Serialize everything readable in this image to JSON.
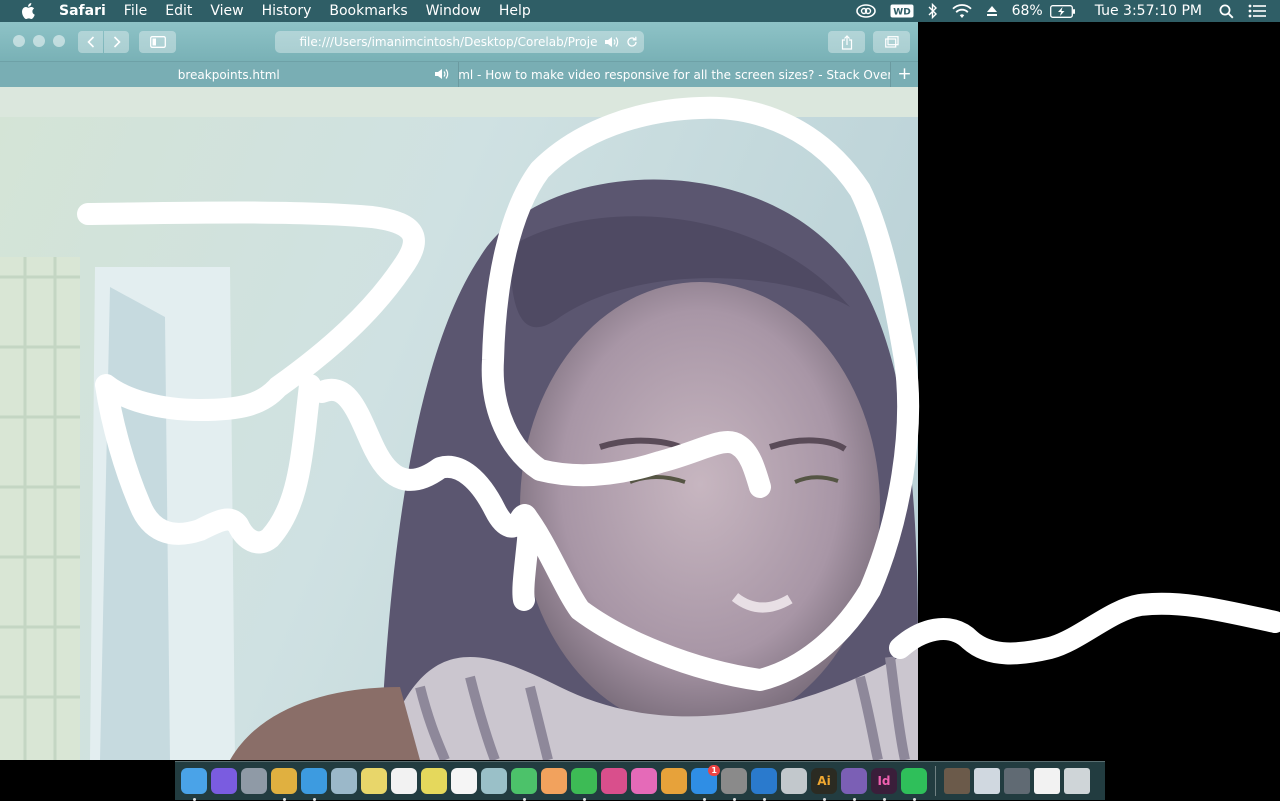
{
  "menubar": {
    "app_name": "Safari",
    "menus": [
      "File",
      "Edit",
      "View",
      "History",
      "Bookmarks",
      "Window",
      "Help"
    ],
    "battery_percent": "68%",
    "clock": "Tue 3:57:10 PM",
    "wd_label": "WD",
    "status_icons": [
      "creative-cloud-icon",
      "wd-drive-icon",
      "bluetooth-icon",
      "wifi-icon",
      "eject-icon",
      "battery-icon",
      "spotlight-search-icon",
      "notification-center-icon"
    ]
  },
  "browser": {
    "url": "file:///Users/imanimcintosh/Desktop/Corelab/Proje",
    "tabs": [
      {
        "label": "breakpoints.html",
        "active": true,
        "audio": true
      },
      {
        "label": "html - How to make video responsive for all the screen sizes? - Stack Over...",
        "active": false
      }
    ],
    "new_tab_label": "+"
  },
  "dock": {
    "apps": [
      {
        "name": "Finder",
        "color": "#4aa3e8",
        "running": true
      },
      {
        "name": "Siri",
        "color": "#7a5ce0",
        "running": false
      },
      {
        "name": "Launchpad",
        "color": "#8f9aa6",
        "running": false
      },
      {
        "name": "Chrome",
        "color": "#e0b040",
        "running": true
      },
      {
        "name": "Safari",
        "color": "#3d9be0",
        "running": true
      },
      {
        "name": "Preview",
        "color": "#9bb8c9",
        "running": false
      },
      {
        "name": "Notes",
        "color": "#e8d66a",
        "running": false
      },
      {
        "name": "Calendar",
        "color": "#f2f2f2",
        "running": false
      },
      {
        "name": "Stickies",
        "color": "#e5d85c",
        "running": false
      },
      {
        "name": "Reminders",
        "color": "#f5f5f5",
        "running": false
      },
      {
        "name": "Script Editor",
        "color": "#9ac0c8",
        "running": false
      },
      {
        "name": "Messages",
        "color": "#4cc26a",
        "running": true
      },
      {
        "name": "Photos",
        "color": "#f2a25d",
        "running": false
      },
      {
        "name": "FaceTime",
        "color": "#3dbb55",
        "running": true
      },
      {
        "name": "No Entry",
        "color": "#d94f8c",
        "running": false
      },
      {
        "name": "iTunes",
        "color": "#e56ab8",
        "running": false
      },
      {
        "name": "iBooks",
        "color": "#e7a23a",
        "running": false
      },
      {
        "name": "App Store",
        "color": "#2f8ee5",
        "running": true
      },
      {
        "name": "System Preferences",
        "color": "#8a8a8a",
        "running": true
      },
      {
        "name": "VS Code",
        "color": "#2a7acd",
        "running": true
      },
      {
        "name": "Photo Booth",
        "color": "#c2c8cc",
        "running": false
      },
      {
        "name": "Illustrator",
        "color": "#2b2b22",
        "running": true
      },
      {
        "name": "GitHub Desktop",
        "color": "#7b5fb5",
        "running": true
      },
      {
        "name": "InDesign",
        "color": "#3a1e3a",
        "running": true
      },
      {
        "name": "Spotify",
        "color": "#2fbf5a",
        "running": true
      }
    ],
    "stacks": [
      {
        "name": "Downloads stack",
        "color": "#6b5a4a"
      },
      {
        "name": "Documents stack",
        "color": "#d0d8e0"
      },
      {
        "name": "Screenshots stack",
        "color": "#606a73"
      },
      {
        "name": "Desktop stack",
        "color": "#f2f2f2"
      },
      {
        "name": "Trash",
        "color": "#cfd5d8"
      }
    ],
    "badges": {
      "App Store": "1"
    },
    "app_text": {
      "Illustrator": "Ai",
      "InDesign": "Id"
    }
  }
}
